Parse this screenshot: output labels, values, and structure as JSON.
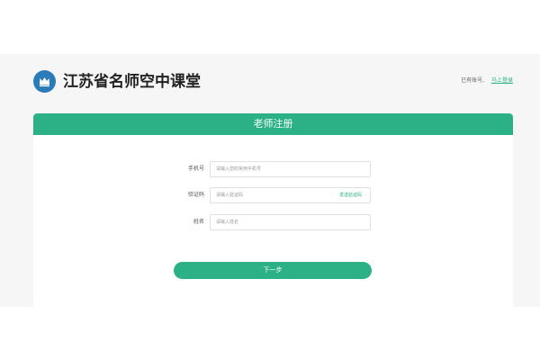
{
  "header": {
    "site_title": "江苏省名师空中课堂",
    "login_hint": "已有账号,",
    "login_link": "马上登录"
  },
  "form": {
    "title": "老师注册",
    "fields": [
      {
        "label": "手机号",
        "placeholder": "请输入您的常用手机号"
      },
      {
        "label": "验证码",
        "placeholder": "请输入验证码",
        "action": "发送验证码"
      },
      {
        "label": "姓名",
        "placeholder": "请输入姓名"
      }
    ],
    "submit_label": "下一步"
  },
  "colors": {
    "accent": "#2bb185",
    "logo": "#2a7bb8",
    "background": "#f6f6f6"
  },
  "icons": {
    "logo": "crown-logo-icon"
  }
}
